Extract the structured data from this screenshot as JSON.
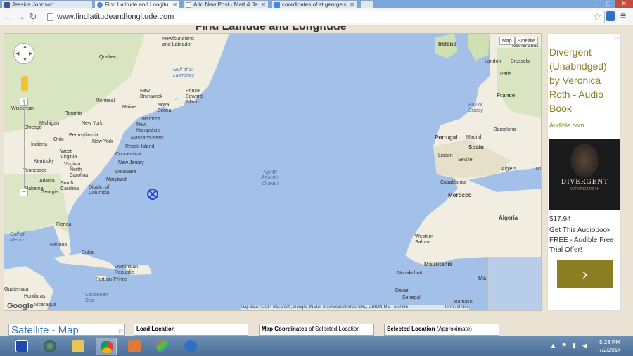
{
  "browser": {
    "tabs": [
      {
        "label": "Jessica Johnson",
        "icon": "facebook-icon",
        "active": false
      },
      {
        "label": "Find Latitude and Longitu",
        "icon": "globe-icon",
        "active": true
      },
      {
        "label": "Add New Post ‹ Matt & Je",
        "icon": "page-icon",
        "active": false
      },
      {
        "label": "coordinates of st george's",
        "icon": "google-icon",
        "active": false
      }
    ],
    "url": "www.findlatitudeandlongitude.com",
    "window_controls": [
      "–",
      "□",
      "✕"
    ]
  },
  "page": {
    "title": "Find Latitude and Longitude"
  },
  "map": {
    "map_types": [
      "Map",
      "Satellite"
    ],
    "zoom_in": "+",
    "zoom_out": "−",
    "attribution": "Map data ©2014 Basarsoft, Google, INEGI, Inav/Geosistemas SRL, ORION-ME",
    "scale": "500 km",
    "terms": "Terms of Use",
    "google_logo": "Google",
    "ocean_label": "North\nAtlantic\nOcean",
    "labels": {
      "newfoundland": "Newfoundland\nand Labrador",
      "quebec": "Quebec",
      "gulf_st_lawrence": "Gulf of St\nLawrence",
      "new_brunswick": "New\nBrunswick",
      "pei": "Prince\nEdward\nIsland",
      "nova_scotia": "Nova\nScotia",
      "maine": "Maine",
      "montreal": "Montreal",
      "wisconsin": "Wisconsin",
      "toronto": "Toronto",
      "vermont": "Vermont",
      "new_hampshire": "New\nHampshire",
      "michigan": "Michigan",
      "new_york_state": "New York",
      "massachusetts": "Massachusetts",
      "chicago": "Chicago",
      "pennsylvania": "Pennsylvania",
      "rhode_island": "Rhode Island",
      "ohio": "Ohio",
      "new_york_city": "New York",
      "connecticut": "Connecticut",
      "indiana": "Indiana",
      "west_virginia": "West\nVirginia",
      "new_jersey": "New Jersey",
      "kentucky": "Kentucky",
      "virginia": "Virginia",
      "delaware": "Delaware",
      "tennessee": "Tennessee",
      "north_carolina": "North\nCarolina",
      "maryland": "Maryland",
      "atlanta": "Atlanta",
      "south_carolina": "South\nCarolina",
      "dc": "District of\nColumbia",
      "alabama": "Alabama",
      "georgia": "Georgia",
      "florida": "Florida",
      "gulf_mexico": "Gulf of\nMexico",
      "havana": "Havana",
      "cuba": "Cuba",
      "dominican_republic": "Dominican\nRepublic",
      "port_au_prince": "Port-au-Prince",
      "caribbean_sea": "Caribbean\nSea",
      "guatemala": "Guatemala",
      "honduras": "Honduras",
      "nicaragua": "Nicaragua",
      "ireland": "Ireland",
      "netherlands": "Netherlands",
      "london": "London",
      "brussels": "Brussels",
      "paris": "Paris",
      "france": "France",
      "bay_of_biscay": "Bay of\nBiscay",
      "barcelona": "Barcelona",
      "portugal": "Portugal",
      "madrid": "Madrid",
      "spain": "Spain",
      "lisbon": "Lisbon",
      "seville": "Seville",
      "algiers": "Algiers",
      "tunis": "Tunis",
      "casablanca": "Casablanca",
      "morocco": "Morocco",
      "algeria": "Algeria",
      "western_sahara": "Western\nSahara",
      "mauritania": "Mauritania",
      "nouakchott": "Nouakchott",
      "dakar": "Dakar",
      "senegal": "Senegal",
      "bamako": "Bamako",
      "ma": "Ma"
    }
  },
  "ad": {
    "adchoices": "▷",
    "title": "Divergent (Unabridged) by Veronica Roth - Audio Book",
    "domain": "Audible.com",
    "cover_title": "DIVERGENT",
    "cover_author": "VERONICA ROTH",
    "price": "$17.94",
    "description": "Get This Audiobook FREE - Audible Free Trial Offer!",
    "cta": "›"
  },
  "lower": {
    "satellite": "Satellite - Map",
    "load_location": "Load Location",
    "map_coordinates_bold": "Map Coordinates",
    "map_coordinates_rest": " of Selected Location",
    "selected_location_bold": "Selected Location",
    "selected_location_rest": " (Approximate)"
  },
  "taskbar": {
    "apps": [
      "help-icon",
      "media-icon",
      "explorer-icon",
      "chrome-icon",
      "paint-icon",
      "palette-icon",
      "thunderbird-icon"
    ],
    "time": "5:23 PM",
    "date": "7/2/2014"
  },
  "colors": {
    "ocean": "#a3c0e9",
    "land": "#f1ede0",
    "land_green": "#cfe0b2",
    "ad_accent": "#8b7d22",
    "marker": "#2a43c9"
  }
}
